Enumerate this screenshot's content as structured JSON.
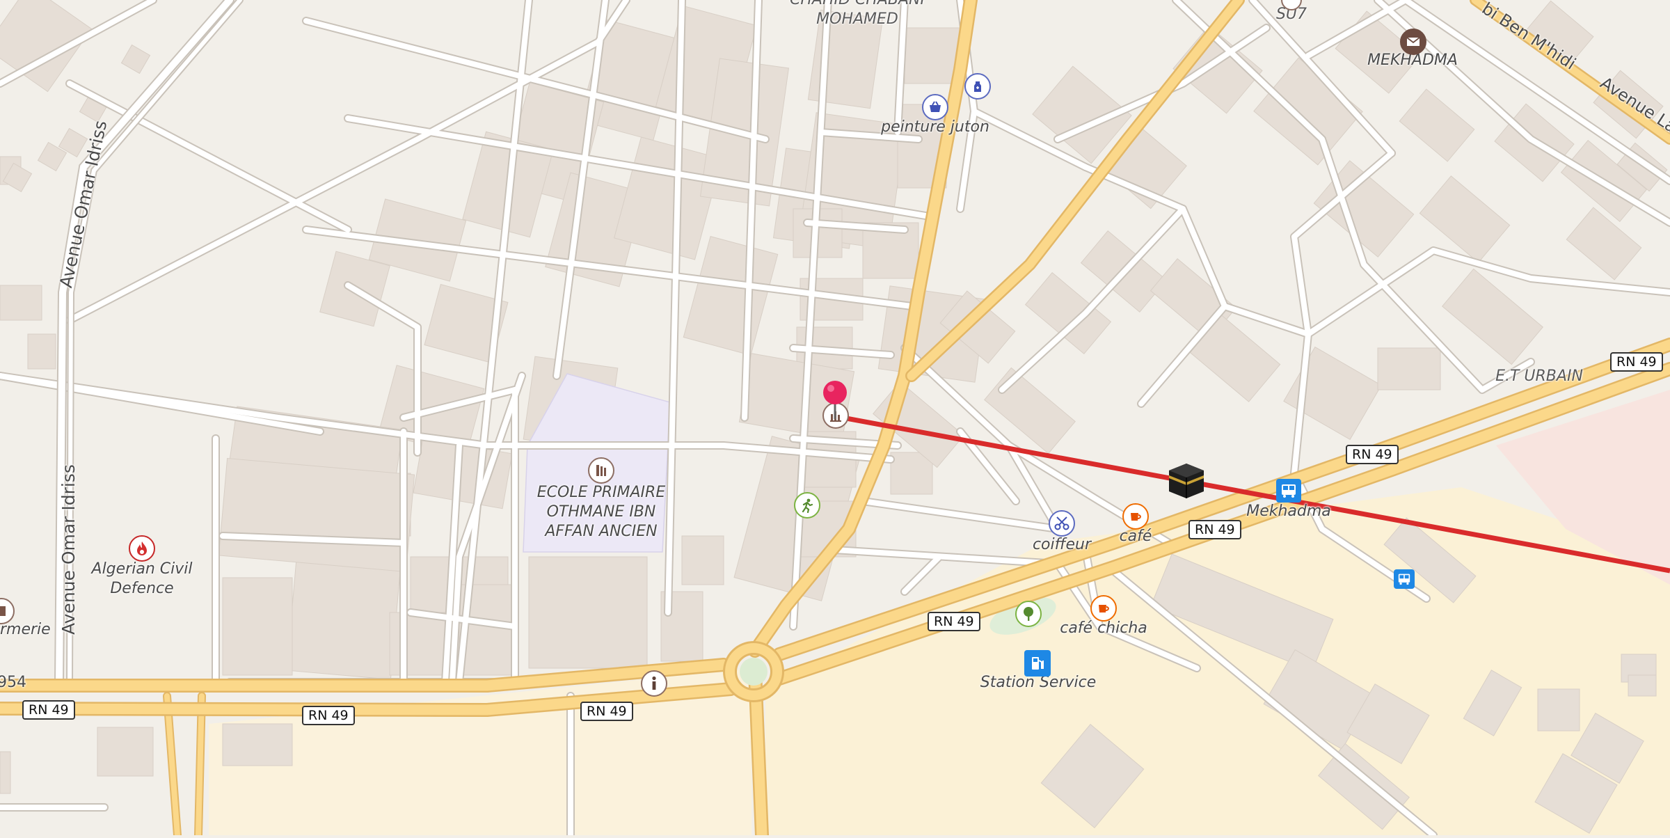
{
  "map": {
    "colors": {
      "background": "#f2efe9",
      "building": "#e6ded6",
      "street": "#ffffff",
      "major_road": "#fbd88a",
      "school_area": "#ece8f6",
      "route_line": "#d92b2b",
      "pin": "#e8245f"
    },
    "streets": {
      "omar_idriss_top": "Avenue Omar Idriss",
      "omar_idriss_bottom": "Avenue Omar Idriss",
      "ben_mhidi": "bi Ben M'hidi",
      "lamine": "Avenue La"
    },
    "road_refs": {
      "rn49_a": "RN 49",
      "rn49_b": "RN 49",
      "rn49_c": "RN 49",
      "rn49_d": "RN 49",
      "rn49_e": "RN 49",
      "rn49_f": "RN 49",
      "rn49_g": "RN 49",
      "partial_left": "954"
    },
    "places": {
      "chahid": "CHAHID CHABANI\nMOHAMED",
      "su7": "SU7",
      "mekhadma_post": "MEKHADMA",
      "peinture": "peinture juton",
      "et_urbain": "E.T URBAIN",
      "ecole": "ECOLE PRIMAIRE\nOTHMANE IBN\nAFFAN ANCIEN",
      "civil_defence": "Algerian Civil\nDefence",
      "pharmacie_partial": "rmerie",
      "coiffeur": "coiffeur",
      "cafe": "café",
      "cafe_chicha": "café chicha",
      "mekhadma_bus": "Mekhadma",
      "station_service": "Station Service"
    },
    "icons": [
      "shopping-basket-icon",
      "pharmacy-icon",
      "post-office-icon",
      "school-icon",
      "fire-station-icon",
      "sports-icon",
      "hairdresser-icon",
      "cafe-icon",
      "park-icon",
      "fuel-icon",
      "bus-stop-icon",
      "information-icon",
      "mosque-kaaba-icon",
      "marker-pin-icon",
      "monument-icon"
    ]
  }
}
